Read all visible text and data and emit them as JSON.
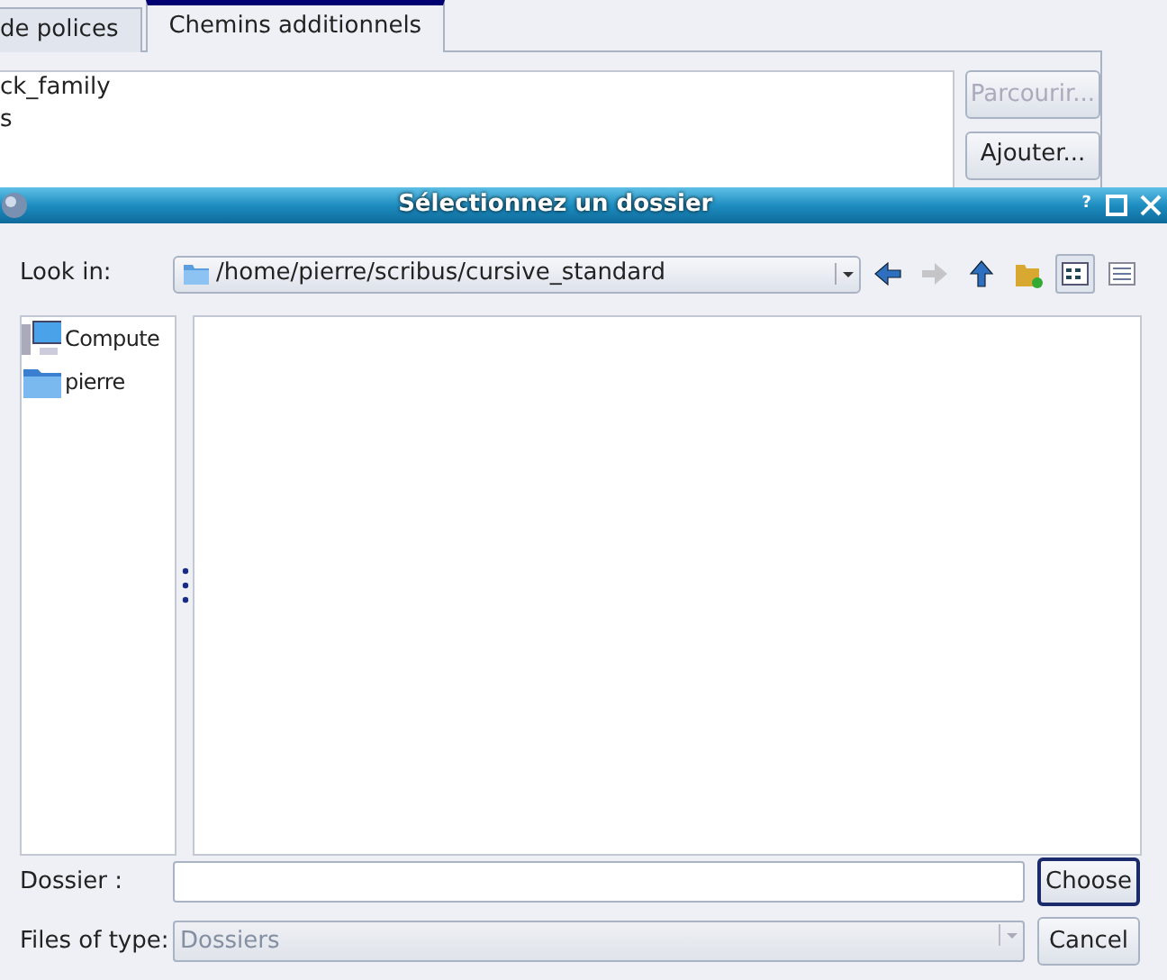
{
  "background_window": {
    "tabs": [
      {
        "label": "de polices",
        "selected": false
      },
      {
        "label": "Chemins additionnels",
        "selected": true
      }
    ],
    "paths": [
      "ck_family",
      "s"
    ],
    "buttons": [
      {
        "label": "Parcourir...",
        "disabled": true
      },
      {
        "label": "Ajouter...",
        "disabled": false
      }
    ]
  },
  "dialog": {
    "title": "Sélectionnez un dossier",
    "help": "?",
    "look_in": {
      "label": "Look in:",
      "path": "/home/pierre/scribus/cursive_standard"
    },
    "toolbar": [
      {
        "kind": "back",
        "disabled": false,
        "selected": false
      },
      {
        "kind": "forward",
        "disabled": true,
        "selected": false
      },
      {
        "kind": "up",
        "disabled": false,
        "selected": false
      },
      {
        "kind": "new-folder",
        "disabled": false,
        "selected": false
      },
      {
        "kind": "list-view",
        "disabled": false,
        "selected": true
      },
      {
        "kind": "detail-view",
        "disabled": false,
        "selected": false
      }
    ],
    "sidebar": [
      {
        "kind": "computer",
        "label": "Compute"
      },
      {
        "kind": "folder",
        "label": "pierre"
      }
    ],
    "folder_field": {
      "label": "Dossier :"
    },
    "file_type": {
      "label": "Files of type:",
      "value": "Dossiers",
      "disabled": true
    },
    "buttons": [
      {
        "label": "Choose",
        "default": true
      },
      {
        "label": "Cancel",
        "default": false
      }
    ]
  }
}
